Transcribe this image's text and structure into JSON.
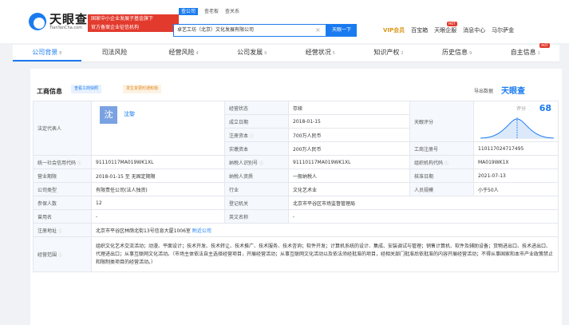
{
  "header": {
    "logo_cn": "天眼查",
    "logo_en": "TianYanCha.com",
    "promo_line1": "国家中小企业发展子基金旗下",
    "promo_line2": "官方备案企业征信机构",
    "search_tabs": [
      "查公司",
      "查老板",
      "查关系"
    ],
    "search_value": "卓艺工坊（北京）文化发展有限公司",
    "search_button": "天眼一下",
    "nav": [
      "VIP会员",
      "百宝箱",
      "天眼企服",
      "消息中心",
      "马尔萨金"
    ],
    "hot_badge": "HOT"
  },
  "tabs": [
    {
      "label": "公司背景",
      "count": "8"
    },
    {
      "label": "司法风险",
      "count": ""
    },
    {
      "label": "经营风险",
      "count": "4"
    },
    {
      "label": "公司发展",
      "count": "9"
    },
    {
      "label": "经营状况",
      "count": "5"
    },
    {
      "label": "知识产权",
      "count": "2"
    },
    {
      "label": "历史信息",
      "count": "9"
    },
    {
      "label": "自主信息",
      "count": "1"
    }
  ],
  "section": {
    "title": "工商信息",
    "pill_blue": "查看工商快照",
    "pill_orange": "发生变更时通知我",
    "export": "导出数据",
    "brand": "天眼查"
  },
  "legal_rep": {
    "label": "法定代表人",
    "avatar_char": "沈",
    "name": "沈黎"
  },
  "score": {
    "label": "天眼评分",
    "score_label": "评分",
    "value": "68"
  },
  "rows": {
    "status_k": "经营状态",
    "status_v": "存续",
    "estab_k": "成立日期",
    "estab_v": "2018-01-15",
    "regcap_k": "注册资本",
    "regcap_v": "700万人民币",
    "paidcap_k": "实缴资本",
    "paidcap_v": "200万人民币",
    "regno_k": "工商注册号",
    "regno_v": "110117024717495",
    "uscc_k": "统一社会信用代码",
    "uscc_v": "91110117MA019WK1XL",
    "taxid_k": "纳税人识别号",
    "taxid_v": "91110117MA019WK1XL",
    "orgcode_k": "组织机构代码",
    "orgcode_v": "MA019WK1X",
    "term_k": "营业期限",
    "term_v": "2018-01-15 至 无固定期限",
    "taxq_k": "纳税人资质",
    "taxq_v": "一般纳税人",
    "approve_k": "核准日期",
    "approve_v": "2021-07-13",
    "type_k": "公司类型",
    "type_v": "有限责任公司(法人独资)",
    "industry_k": "行业",
    "industry_v": "文化艺术业",
    "staff_k": "人员规模",
    "staff_v": "小于50人",
    "insured_k": "参保人数",
    "insured_v": "12",
    "authority_k": "登记机关",
    "authority_v": "北京市平谷区市场监督管理局",
    "former_k": "曾用名",
    "former_v": "-",
    "en_k": "英文名称",
    "en_v": "-",
    "addr_k": "注册地址",
    "addr_v": "北京市平谷区林荫北街13号信息大厦1006室",
    "addr_link": "附近公司",
    "scope_k": "经营范围",
    "scope_v": "组织文化艺术交流活动；动漫、平面设计；技术开发、技术转让、技术推广、技术服务、技术咨询；软件开发；计算机系统的设计、集成、安装调试与管理；销售计算机、软件及辅助设备；货物进出口、技术进出口、代理进出口；从事互联网文化活动。（市场主体依法自主选择经营项目，开展经营活动；从事互联网文化活动以及依法须经批准的项目，经相关部门批准后依批准的内容开展经营活动；不得从事国家和本市产业政策禁止和限制类项目的经营活动。）"
  },
  "colors": {
    "accent": "#1a7bf0",
    "promo": "#e23b2e",
    "key_bg": "#f5f8fc"
  }
}
